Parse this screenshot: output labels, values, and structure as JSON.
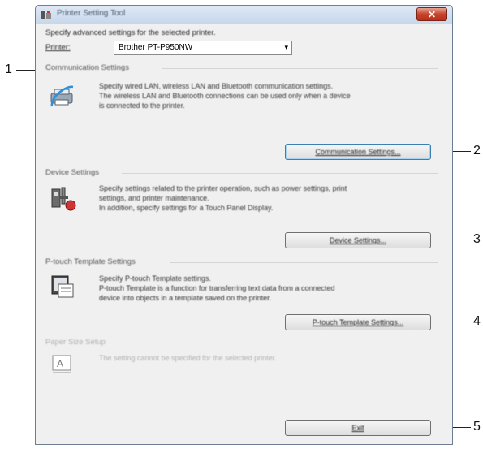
{
  "window": {
    "title": "Printer Setting Tool",
    "close_label": "✕"
  },
  "intro": "Specify advanced settings for the selected printer.",
  "printer": {
    "label": "Printer:",
    "value": "Brother PT-P950NW",
    "arrow": "▾"
  },
  "sections": [
    {
      "label": "Communication Settings",
      "icon": "network-printer-icon",
      "desc": [
        "Specify wired LAN, wireless LAN and Bluetooth communication settings.",
        "The wireless LAN and Bluetooth connections can be used only when a device",
        "is connected to the printer."
      ],
      "button": "Communication Settings..."
    },
    {
      "label": "Device Settings",
      "icon": "tools-icon",
      "desc": [
        "Specify settings related to the printer operation, such as power settings, print",
        "settings, and printer maintenance.",
        "In addition, specify settings for a Touch Panel Display."
      ],
      "button": "Device Settings..."
    },
    {
      "label": "P-touch Template Settings",
      "icon": "template-icon",
      "desc": [
        "Specify P-touch Template settings.",
        "P-touch Template is a function for transferring text data from a connected",
        "device into objects in a template saved on the printer."
      ],
      "button": "P-touch Template Settings..."
    },
    {
      "label": "Paper Size Setup",
      "icon": "paper-size-icon",
      "desc": [
        "The setting cannot be specified for the selected printer."
      ]
    }
  ],
  "exit_button": "Exit",
  "callouts": [
    "1",
    "2",
    "3",
    "4",
    "5"
  ]
}
